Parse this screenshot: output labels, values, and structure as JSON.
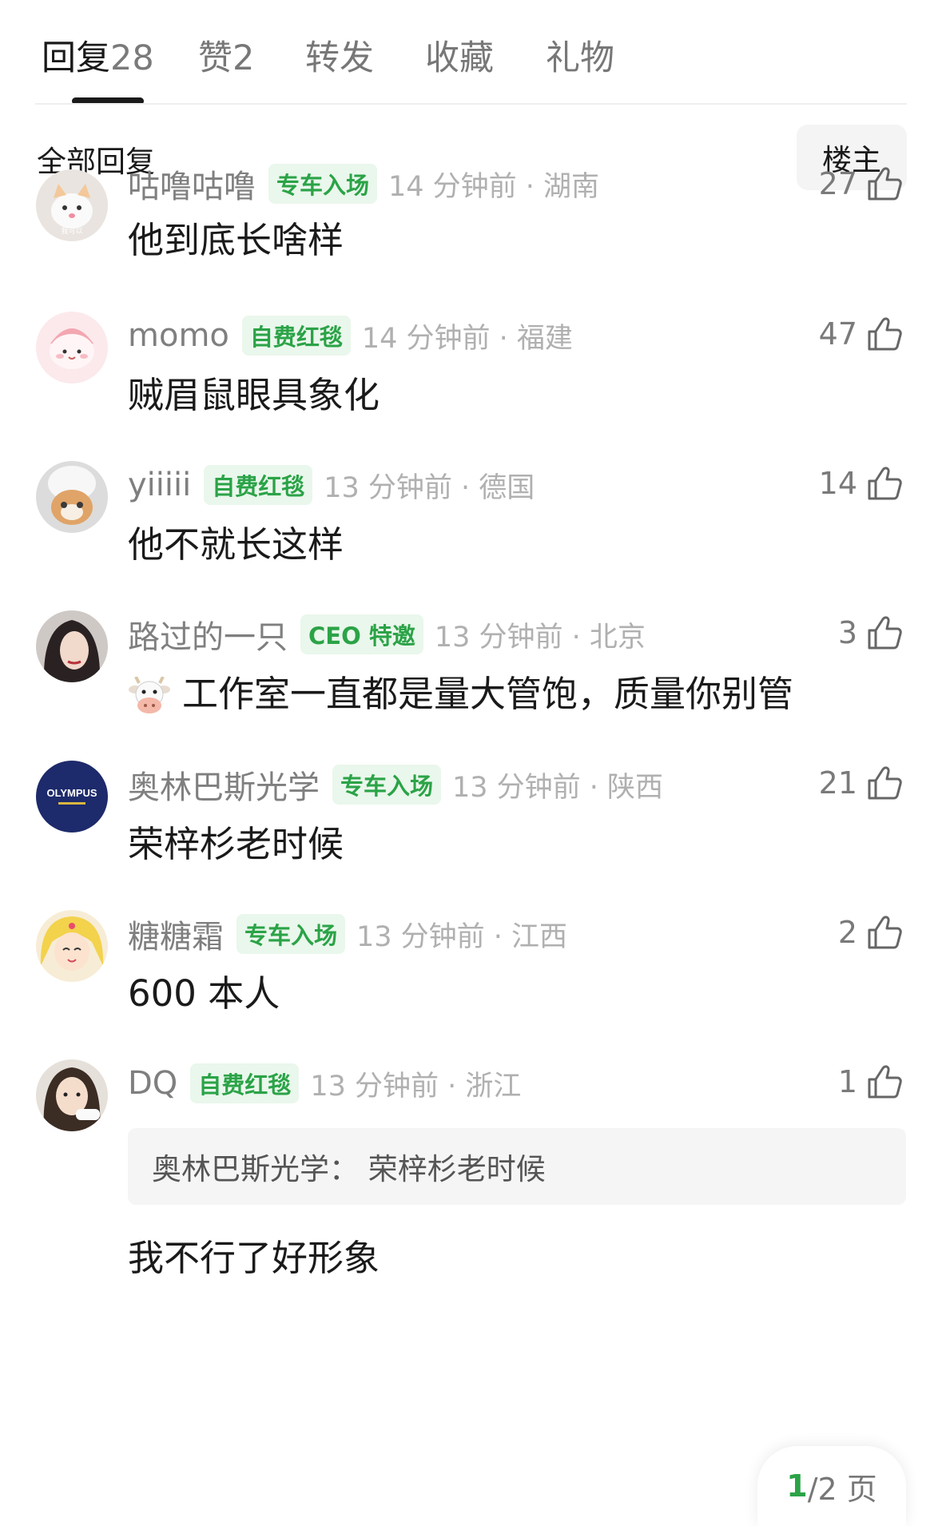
{
  "tabs": [
    {
      "label": "回复",
      "count": "28"
    },
    {
      "label": "赞",
      "count": "2"
    },
    {
      "label": "转发",
      "count": ""
    },
    {
      "label": "收藏",
      "count": ""
    },
    {
      "label": "礼物",
      "count": ""
    }
  ],
  "subheader": {
    "title": "全部回复",
    "owner_button": "楼主"
  },
  "comments": [
    {
      "user": "咕噜咕噜",
      "badge": "专车入场",
      "time": "14 分钟前 · 湖南",
      "likes": "27",
      "text": "他到底长啥样",
      "avatar_caption": "我可以"
    },
    {
      "user": "momo",
      "badge": "自费红毯",
      "time": "14 分钟前 · 福建",
      "likes": "47",
      "text": "贼眉鼠眼具象化"
    },
    {
      "user": "yiiiii",
      "badge": "自费红毯",
      "time": "13 分钟前 · 德国",
      "likes": "14",
      "text": "他不就长这样"
    },
    {
      "user": "路过的一只",
      "badge": "CEO 特邀",
      "time": "13 分钟前 · 北京",
      "likes": "3",
      "text": "工作室一直都是量大管饱，质量你别管",
      "emoji": "cow-face-icon"
    },
    {
      "user": "奥林巴斯光学",
      "badge": "专车入场",
      "time": "13 分钟前 · 陕西",
      "likes": "21",
      "text": "荣梓杉老时候",
      "avatar_logo": "OLYMPUS"
    },
    {
      "user": "糖糖霜",
      "badge": "专车入场",
      "time": "13 分钟前 · 江西",
      "likes": "2",
      "text": "600 本人"
    },
    {
      "user": "DQ",
      "badge": "自费红毯",
      "time": "13 分钟前 · 浙江",
      "likes": "1",
      "quote": "奥林巴斯光学：  荣梓杉老时候",
      "text": "我不行了好形象"
    }
  ],
  "pager": {
    "current": "1",
    "total": "/2 页"
  },
  "colors": {
    "badge_green": "#2ba347",
    "badge_bg": "#eaf7ec"
  }
}
